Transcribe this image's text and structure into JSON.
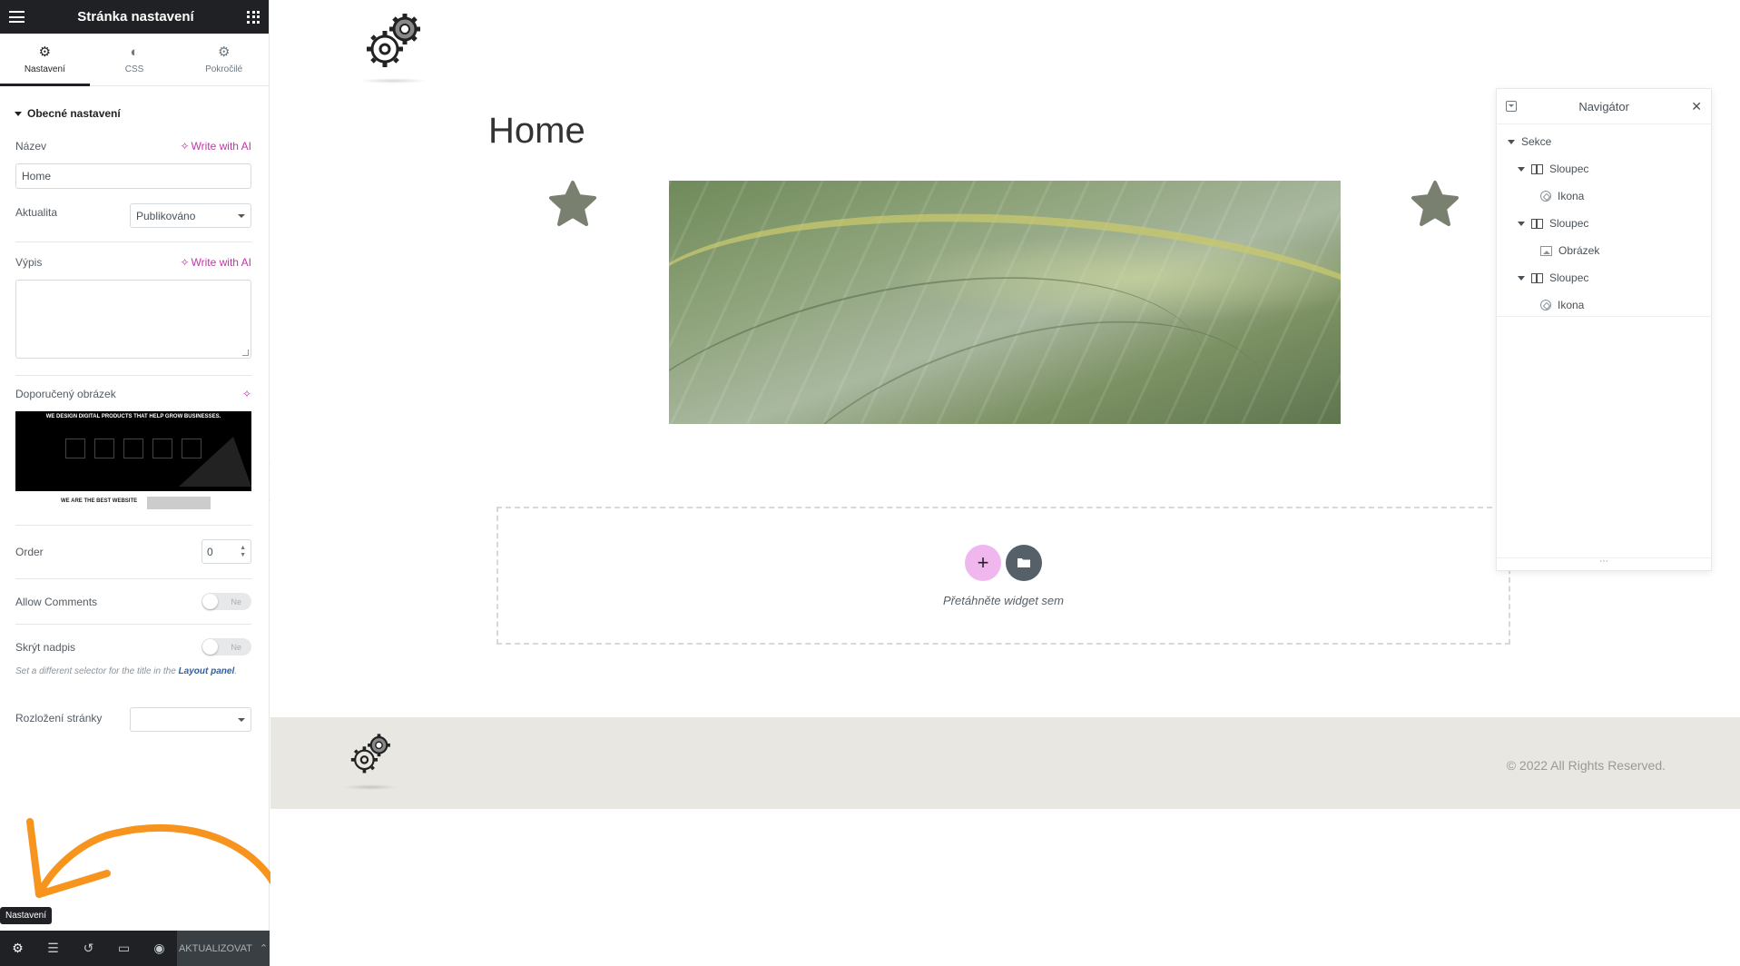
{
  "panel": {
    "title": "Stránka nastavení",
    "tabs": [
      {
        "label": "Nastavení",
        "icon": "gear-icon"
      },
      {
        "label": "CSS",
        "icon": "half-circle-icon"
      },
      {
        "label": "Pokročilé",
        "icon": "gear-icon"
      }
    ],
    "section_title": "Obecné nastavení",
    "title_label": "Název",
    "write_ai": "Write with AI",
    "title_value": "Home",
    "status_label": "Aktualita",
    "status_value": "Publikováno",
    "excerpt_label": "Výpis",
    "excerpt_ai": "Write with AI",
    "featured_label": "Doporučený obrázek",
    "featured_img_heading": "WE DESIGN DIGITAL PRODUCTS THAT HELP GROW BUSINESSES.",
    "featured_img_bottom": "WE ARE THE BEST WEBSITE",
    "order_label": "Order",
    "order_value": "0",
    "comments_label": "Allow Comments",
    "comments_toggle": "Ne",
    "hide_title_label": "Skrýt nadpis",
    "hide_title_toggle": "Ne",
    "help_text_prefix": "Set a different selector for the title in the",
    "help_text_link": "Layout panel",
    "help_text_suffix": ".",
    "layout_label": "Rozložení stránky",
    "layout_value": ""
  },
  "bottom_bar": {
    "tooltip": "Nastavení",
    "update_label": "AKTUALIZOVAT"
  },
  "canvas": {
    "page_title": "Home",
    "dropzone_text": "Přetáhněte widget sem",
    "footer_copy": "© 2022 All Rights Reserved."
  },
  "navigator": {
    "title": "Navigátor",
    "items": [
      {
        "label": "Sekce"
      },
      {
        "label": "Sloupec"
      },
      {
        "label": "Ikona"
      },
      {
        "label": "Sloupec"
      },
      {
        "label": "Obrázek"
      },
      {
        "label": "Sloupec"
      },
      {
        "label": "Ikona"
      }
    ]
  },
  "colors": {
    "accent_ai": "#c036a8",
    "panel_dark": "#1f2124",
    "add_button": "#f0b7ee",
    "star": "#7a8070",
    "footer_bg": "#e8e7e2",
    "arrow": "#f7941d"
  }
}
